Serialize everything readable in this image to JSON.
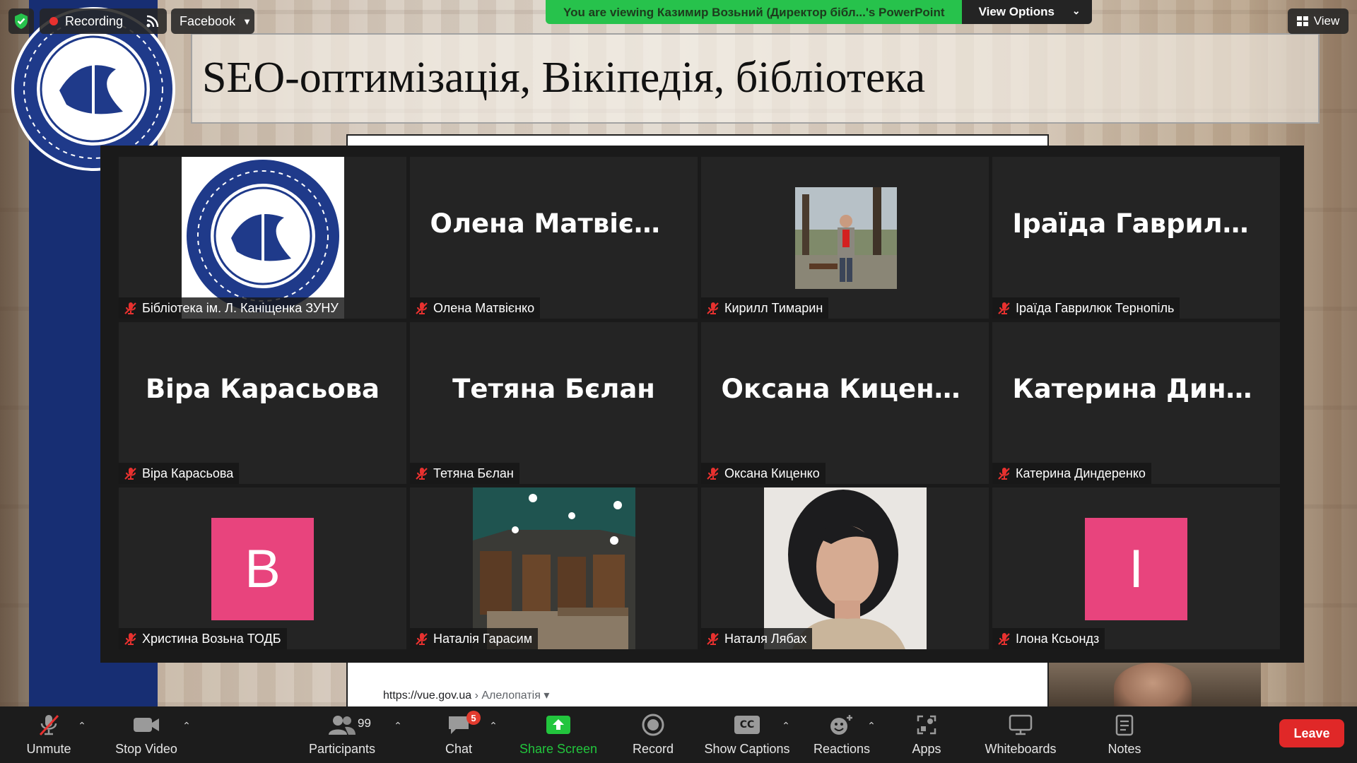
{
  "colors": {
    "banner_green": "#27c24c",
    "toolbar_bg": "#1c1c1c",
    "tile_bg": "#242424",
    "avatar_pink": "#e8447d",
    "leave_red": "#e02828",
    "share_green": "#22c53d",
    "muted_red": "#e8312f",
    "slide_band_blue": "#172e73"
  },
  "top_bar": {
    "security_icon": "shield-check-icon",
    "recording_label": "Recording",
    "recording_icon": "red-dot-icon",
    "stream_icon": "live-stream-icon",
    "live_stream_label": "Facebook",
    "view_banner_text": "You are viewing Казимир Возьний (Директор бібл...'s PowerPoint",
    "view_options_label": "View Options",
    "view_label": "View"
  },
  "slide": {
    "title": "SEO-оптимізація, Вікіпедія, бібліотека",
    "url": "https://vue.gov.ua",
    "url_crumb": "› Алелопатія",
    "logo_icon": "library-seal-logo"
  },
  "gallery": {
    "tiles": [
      {
        "label": "Бібліотека ім. Л. Каніщенка ЗУНУ",
        "display": "logo",
        "muted": true
      },
      {
        "label": "Олена Матвієнко",
        "center_name": "Олена Матвієнко",
        "display": "name",
        "muted": true
      },
      {
        "label": "Кирилл Тимарин",
        "display": "photo",
        "muted": true
      },
      {
        "label": "Іраїда Гаврилюк Тернопіль",
        "center_name": "Іраїда  Гаврилю...",
        "display": "name",
        "muted": true
      },
      {
        "label": "Віра Карасьова",
        "center_name": "Віра Карасьова",
        "display": "name",
        "muted": true
      },
      {
        "label": "Тетяна Бєлан",
        "center_name": "Тетяна Бєлан",
        "display": "name",
        "muted": true
      },
      {
        "label": "Оксана Киценко",
        "center_name": "Оксана Киценко",
        "display": "name",
        "muted": true
      },
      {
        "label": "Катерина Диндеренко",
        "center_name": "Катерина  Динд...",
        "display": "name",
        "muted": true
      },
      {
        "label": "Христина Возьна ТОДБ",
        "avatar_letter": "B",
        "display": "avatar",
        "muted": true
      },
      {
        "label": "Наталія Гарасим",
        "display": "photo",
        "muted": true
      },
      {
        "label": "Наталя Лябах",
        "display": "photo",
        "muted": true
      },
      {
        "label": "Ілона Ксьондз",
        "avatar_letter": "I",
        "display": "avatar",
        "muted": true
      }
    ]
  },
  "toolbar": {
    "unmute_label": "Unmute",
    "stop_video_label": "Stop Video",
    "participants_label": "Participants",
    "participants_count": "99",
    "chat_label": "Chat",
    "chat_badge": "5",
    "share_screen_label": "Share Screen",
    "record_label": "Record",
    "captions_label": "Show Captions",
    "captions_icon_text": "CC",
    "reactions_label": "Reactions",
    "apps_label": "Apps",
    "whiteboards_label": "Whiteboards",
    "notes_label": "Notes",
    "leave_label": "Leave"
  }
}
